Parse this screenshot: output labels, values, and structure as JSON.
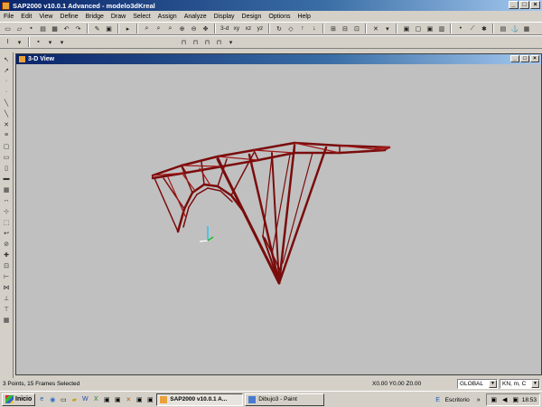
{
  "window": {
    "title": "SAP2000 v10.0.1  Advanced  - modelo3dKreal",
    "minimize": "_",
    "maximize": "□",
    "close": "×"
  },
  "menubar": [
    "File",
    "Edit",
    "View",
    "Define",
    "Bridge",
    "Draw",
    "Select",
    "Assign",
    "Analyze",
    "Display",
    "Design",
    "Options",
    "Help"
  ],
  "toolbar": {
    "view_3d": "3-d",
    "view_xy": "xy",
    "view_xz": "xz",
    "view_yz": "yz"
  },
  "view": {
    "title": "3-D View",
    "minimize": "_",
    "restore": "□",
    "close": "×"
  },
  "status": {
    "selection": "3 Points, 15 Frames Selected",
    "coordinates": "X0.00  Y0.00  Z0.00",
    "coord_system": "GLOBAL",
    "units": "KN, m, C"
  },
  "taskbar": {
    "start": "Inicio",
    "tasks": [
      {
        "label": "SAP2000 v10.0.1  A...",
        "active": true
      },
      {
        "label": "Dibujo3 - Paint",
        "active": false
      }
    ],
    "tray_label": "Escritorio",
    "clock": "18:53"
  },
  "colors": {
    "structure": "#7a0c0c",
    "structure_light": "#a21818",
    "canvas": "#c0c0c0",
    "axis_x": "#ffffff",
    "axis_y": "#00c000",
    "axis_z": "#00c8ff"
  }
}
